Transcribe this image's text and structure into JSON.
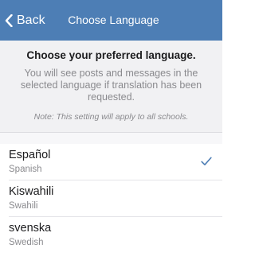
{
  "navbar": {
    "back_label": "Back",
    "title": "Choose Language",
    "color": "#4d7eb5"
  },
  "intro": {
    "heading": "Choose your preferred language.",
    "body": "You will see posts and messages in the selected language if translation has been requested.",
    "note": "Note: This setting will apply to all schools."
  },
  "languages": [
    {
      "name": "Español",
      "english": "Spanish",
      "selected": true
    },
    {
      "name": "Kiswahili",
      "english": "Swahili",
      "selected": false
    },
    {
      "name": "svenska",
      "english": "Swedish",
      "selected": false
    }
  ],
  "icons": {
    "back": "chevron-left-icon",
    "selected": "checkmark-icon"
  },
  "colors": {
    "accent": "#4d7eb5",
    "secondary_text": "#8a8a8e"
  }
}
